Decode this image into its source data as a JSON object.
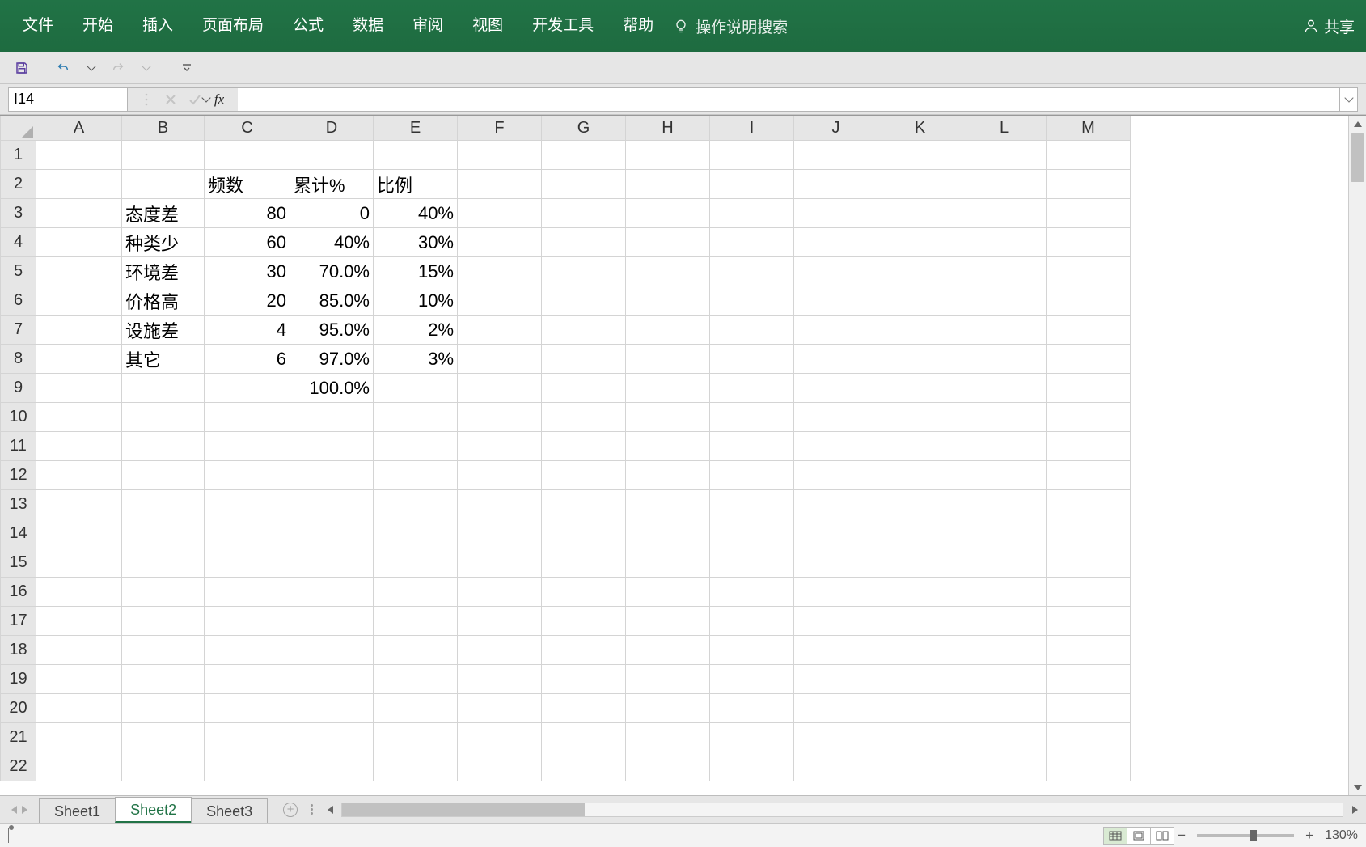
{
  "ribbon": {
    "tabs": [
      "文件",
      "开始",
      "插入",
      "页面布局",
      "公式",
      "数据",
      "审阅",
      "视图",
      "开发工具",
      "帮助"
    ],
    "tell_me": "操作说明搜索",
    "share": "共享"
  },
  "qat": {
    "save": "save",
    "undo": "undo",
    "redo": "redo",
    "customize": "customize"
  },
  "name_box": {
    "value": "I14"
  },
  "formula_bar": {
    "fx": "fx",
    "value": ""
  },
  "columns": [
    "A",
    "B",
    "C",
    "D",
    "E",
    "F",
    "G",
    "H",
    "I",
    "J",
    "K",
    "L",
    "M"
  ],
  "row_count": 22,
  "grid_data": {
    "headers_row": 2,
    "headers": {
      "C": "频数",
      "D": "累计%",
      "E": "比例"
    },
    "rows": [
      {
        "r": 3,
        "B": "态度差",
        "C": "80",
        "D": "0",
        "E": "40%"
      },
      {
        "r": 4,
        "B": "种类少",
        "C": "60",
        "D": "40%",
        "E": "30%"
      },
      {
        "r": 5,
        "B": "环境差",
        "C": "30",
        "D": "70.0%",
        "E": "15%"
      },
      {
        "r": 6,
        "B": "价格高",
        "C": "20",
        "D": "85.0%",
        "E": "10%"
      },
      {
        "r": 7,
        "B": "设施差",
        "C": "4",
        "D": "95.0%",
        "E": "2%"
      },
      {
        "r": 8,
        "B": "其它",
        "C": "6",
        "D": "97.0%",
        "E": "3%"
      },
      {
        "r": 9,
        "D": "100.0%"
      }
    ]
  },
  "sheets": {
    "tabs": [
      "Sheet1",
      "Sheet2",
      "Sheet3"
    ],
    "active": 1
  },
  "status": {
    "zoom": "130%"
  },
  "col_widths": {
    "rowhead": 44,
    "A": 106,
    "B": 102,
    "C": 106,
    "D": 103,
    "E": 104,
    "default": 104
  }
}
